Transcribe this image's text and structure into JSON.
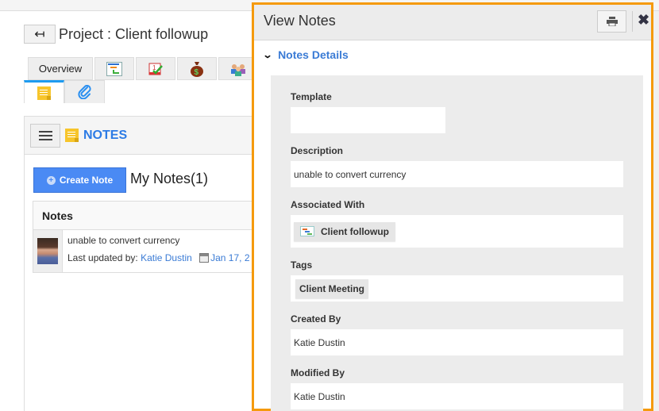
{
  "page": {
    "back_icon": "arrow-left-icon",
    "project_title": "Project : Client followup",
    "tabs_row1": [
      {
        "label": "Overview",
        "icon": null
      },
      {
        "label": "",
        "icon": "gantt-chart-icon"
      },
      {
        "label": "",
        "icon": "calendar-check-icon"
      },
      {
        "label": "",
        "icon": "money-bag-icon"
      },
      {
        "label": "",
        "icon": "team-icon"
      }
    ],
    "tabs_row2": [
      {
        "icon": "notes-icon",
        "active": true
      },
      {
        "icon": "paperclip-icon",
        "active": false
      }
    ]
  },
  "notes_panel": {
    "title": "NOTES",
    "create_button": "Create Note",
    "my_notes": "My Notes(1)",
    "table_header": "Notes",
    "rows": [
      {
        "text": "unable to convert currency",
        "updated_label": "Last updated by:",
        "updated_by": "Katie Dustin",
        "date": "Jan 17, 2"
      }
    ]
  },
  "modal": {
    "title": "View Notes",
    "print_icon": "printer-icon",
    "close_icon": "close-icon",
    "section_title": "Notes Details",
    "fields": {
      "template": {
        "label": "Template",
        "value": ""
      },
      "description": {
        "label": "Description",
        "value": "unable to convert currency"
      },
      "associated_with": {
        "label": "Associated With",
        "value": "Client followup"
      },
      "tags": {
        "label": "Tags",
        "value": "Client Meeting"
      },
      "created_by": {
        "label": "Created By",
        "value": "Katie Dustin"
      },
      "modified_by": {
        "label": "Modified By",
        "value": "Katie Dustin"
      }
    }
  },
  "colors": {
    "accent_blue": "#3a7bd5",
    "button_blue": "#4a8af4",
    "modal_border": "#f59a0d",
    "active_tab": "#1e9bf0"
  }
}
